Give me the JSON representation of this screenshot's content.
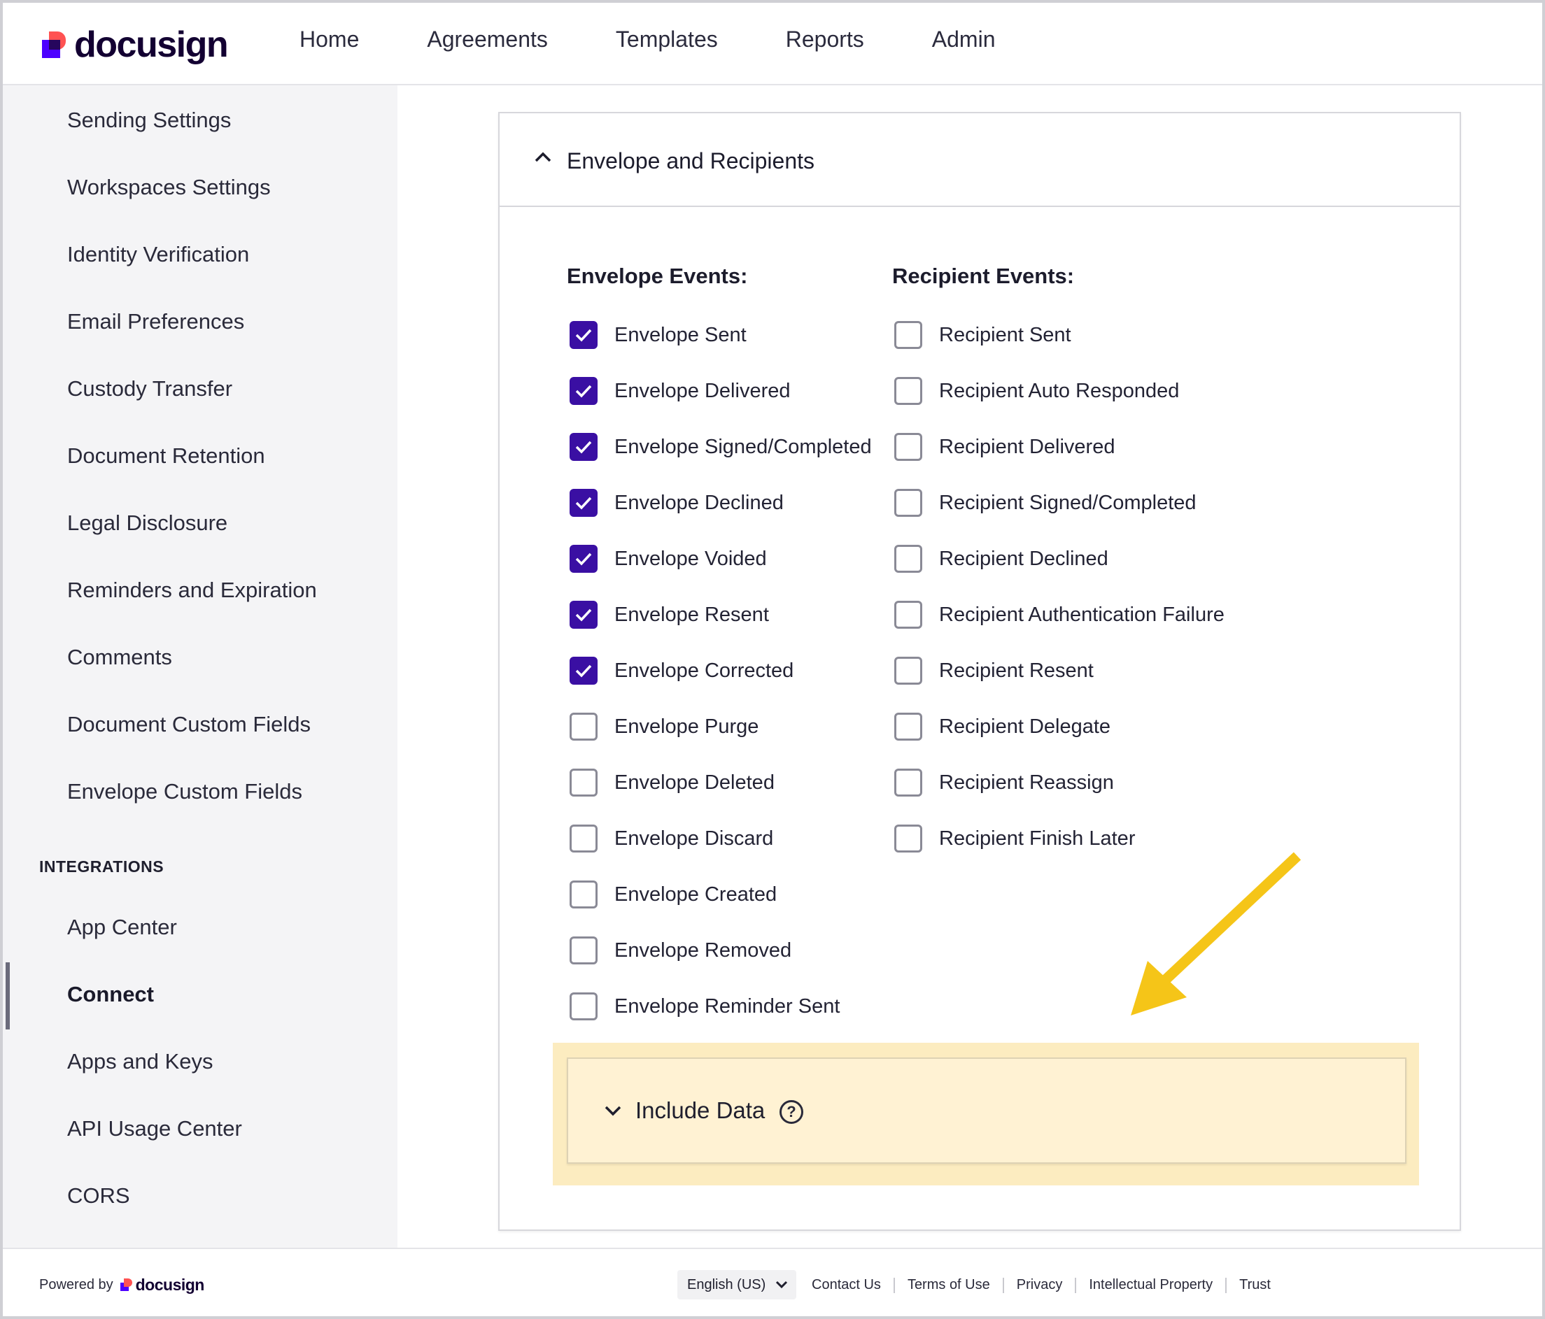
{
  "brand": {
    "logo_text": "docusign",
    "powered_by": "Powered by"
  },
  "nav": {
    "items": [
      "Home",
      "Agreements",
      "Templates",
      "Reports",
      "Admin"
    ]
  },
  "sidebar": {
    "items": [
      "Sending Settings",
      "Workspaces Settings",
      "Identity Verification",
      "Email Preferences",
      "Custody Transfer",
      "Document Retention",
      "Legal Disclosure",
      "Reminders and Expiration",
      "Comments",
      "Document Custom Fields",
      "Envelope Custom Fields"
    ],
    "integrations_heading": "INTEGRATIONS",
    "integrations": [
      "App Center",
      "Connect",
      "Apps and Keys",
      "API Usage Center",
      "CORS"
    ],
    "active_item": "Connect"
  },
  "panel": {
    "title": "Envelope and Recipients",
    "expanded": true,
    "envelope_events_heading": "Envelope Events:",
    "recipient_events_heading": "Recipient Events:",
    "envelope_events": [
      {
        "label": "Envelope Sent",
        "checked": true
      },
      {
        "label": "Envelope Delivered",
        "checked": true
      },
      {
        "label": "Envelope Signed/Completed",
        "checked": true
      },
      {
        "label": "Envelope Declined",
        "checked": true
      },
      {
        "label": "Envelope Voided",
        "checked": true
      },
      {
        "label": "Envelope Resent",
        "checked": true
      },
      {
        "label": "Envelope Corrected",
        "checked": true
      },
      {
        "label": "Envelope Purge",
        "checked": false
      },
      {
        "label": "Envelope Deleted",
        "checked": false
      },
      {
        "label": "Envelope Discard",
        "checked": false
      },
      {
        "label": "Envelope Created",
        "checked": false
      },
      {
        "label": "Envelope Removed",
        "checked": false
      },
      {
        "label": "Envelope Reminder Sent",
        "checked": false
      }
    ],
    "recipient_events": [
      {
        "label": "Recipient Sent",
        "checked": false
      },
      {
        "label": "Recipient Auto Responded",
        "checked": false
      },
      {
        "label": "Recipient Delivered",
        "checked": false
      },
      {
        "label": "Recipient Signed/Completed",
        "checked": false
      },
      {
        "label": "Recipient Declined",
        "checked": false
      },
      {
        "label": "Recipient Authentication Failure",
        "checked": false
      },
      {
        "label": "Recipient Resent",
        "checked": false
      },
      {
        "label": "Recipient Delegate",
        "checked": false
      },
      {
        "label": "Recipient Reassign",
        "checked": false
      },
      {
        "label": "Recipient Finish Later",
        "checked": false
      }
    ],
    "include_data": {
      "label": "Include Data",
      "expanded": false,
      "help_icon": "question-circle-icon"
    }
  },
  "footer": {
    "language": "English (US)",
    "links": [
      "Contact Us",
      "Terms of Use",
      "Privacy",
      "Intellectual Property",
      "Trust"
    ]
  },
  "colors": {
    "accent": "#3a0fa3",
    "highlight": "#fcecc0",
    "annotation_arrow": "#f5c518"
  }
}
